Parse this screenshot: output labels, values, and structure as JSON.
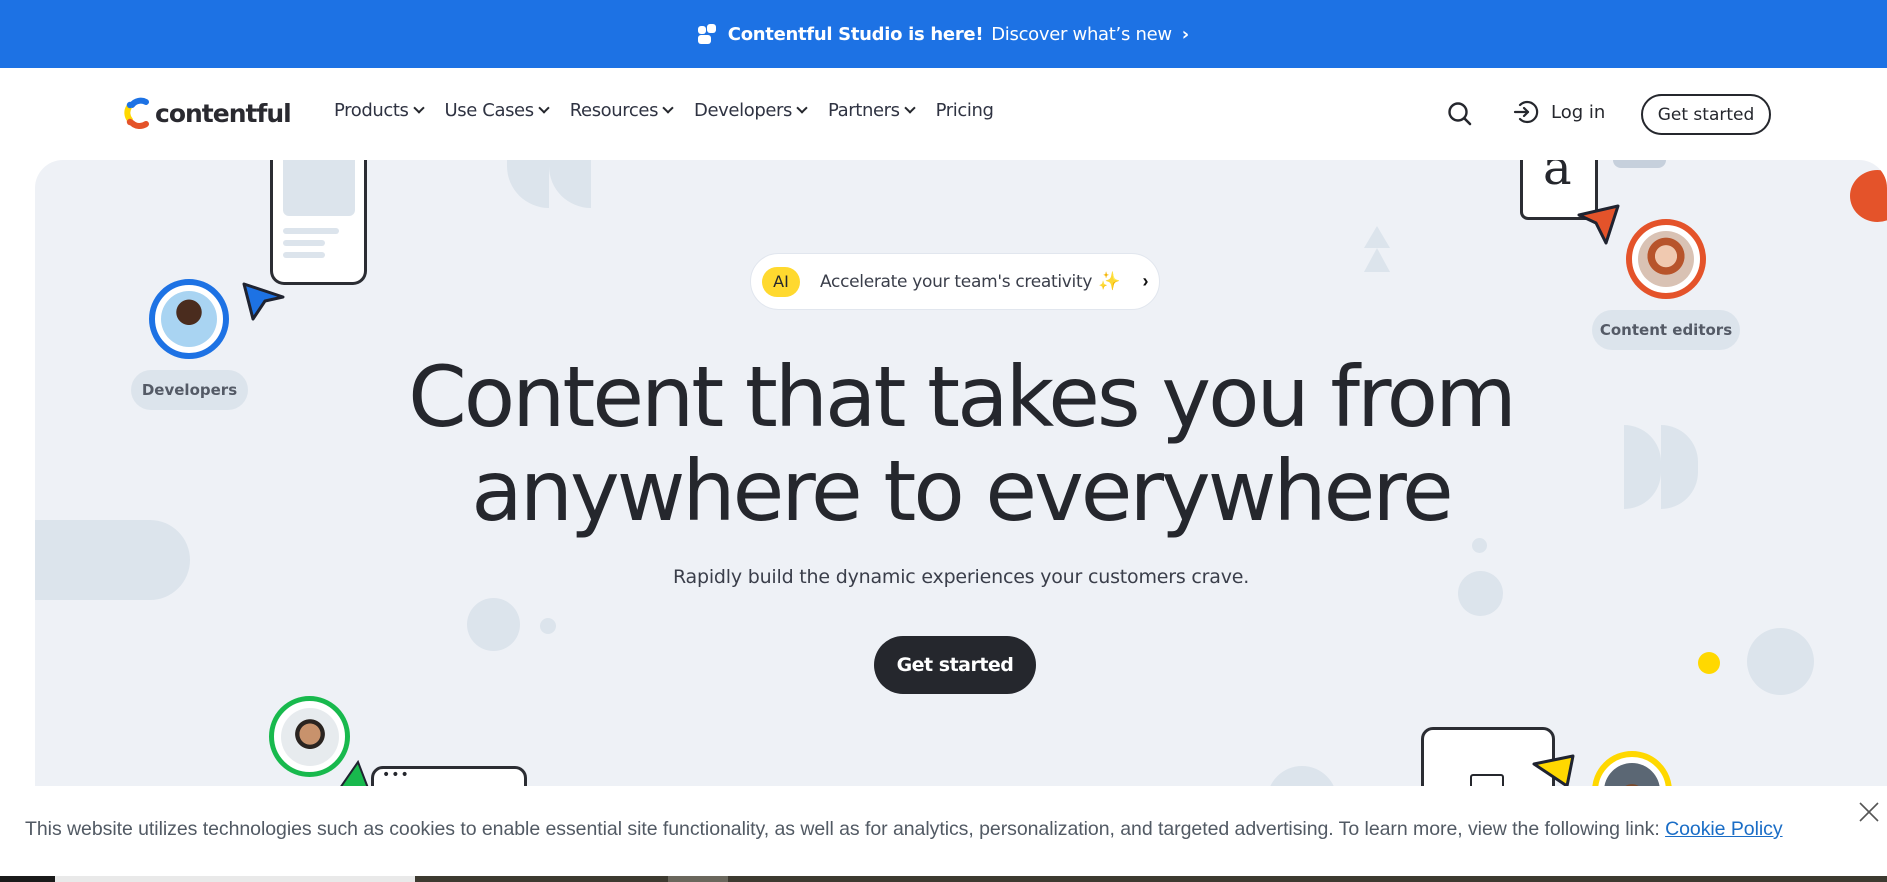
{
  "announcement": {
    "icon": "studio-icon",
    "headline": "Contentful Studio is here!",
    "link": "Discover what’s new",
    "chevron": "›",
    "color": "#1d72e4"
  },
  "nav": {
    "logo_text": "contentful",
    "items": [
      {
        "label": "Products",
        "has_dropdown": true
      },
      {
        "label": "Use Cases",
        "has_dropdown": true
      },
      {
        "label": "Resources",
        "has_dropdown": true
      },
      {
        "label": "Developers",
        "has_dropdown": true
      },
      {
        "label": "Partners",
        "has_dropdown": true
      },
      {
        "label": "Pricing",
        "has_dropdown": false
      }
    ],
    "login_label": "Log in",
    "get_started_label": "Get started"
  },
  "hero": {
    "ai_pill": {
      "badge": "AI",
      "text": "Accelerate your team's creativity",
      "spark": "✨",
      "chevron": "›"
    },
    "headline_line1": "Content that takes you from",
    "headline_line2": "anywhere to everywhere",
    "subheadline": "Rapidly build the dynamic experiences your customers crave.",
    "cta_label": "Get started",
    "roles": [
      {
        "label": "Developers",
        "ring_color": "#1d72e4"
      },
      {
        "label": "Content editors",
        "ring_color": "#e4532a"
      }
    ],
    "card_letter": "a",
    "accent_colors": {
      "blue": "#1d72e4",
      "orange": "#e4532a",
      "green": "#18b94d",
      "yellow": "#ffd800"
    }
  },
  "cookie_banner": {
    "text": "This website utilizes technologies such as cookies to enable essential site functionality, as well as for analytics, personalization, and targeted advertising. To learn more, view the following link: ",
    "link_label": "Cookie Policy",
    "close_icon": "close-icon"
  }
}
